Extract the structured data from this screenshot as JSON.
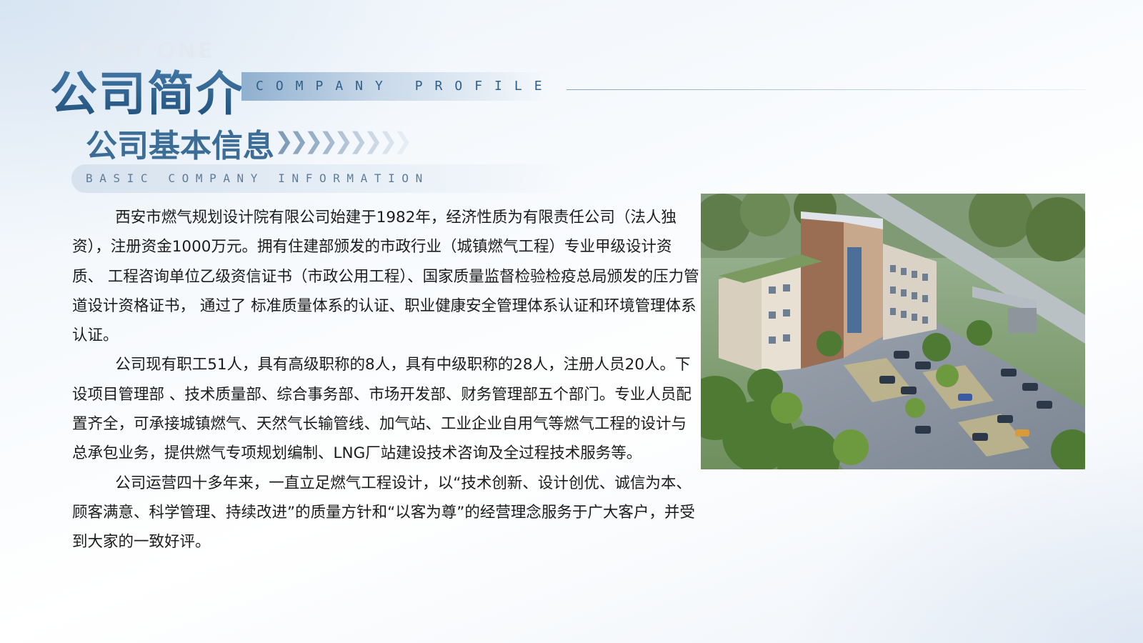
{
  "header": {
    "part_label": "PART ONE",
    "title": "公司简介",
    "subtitle_en": "COMPANY PROFILE"
  },
  "section": {
    "title": "公司基本信息",
    "subtitle_en": "BASIC COMPANY INFORMATION",
    "chevron_glyph": "❯",
    "chevron_count": 9
  },
  "body": {
    "paragraphs": [
      "西安市燃气规划设计院有限公司始建于1982年，经济性质为有限责任公司（法人独资），注册资金1000万元。拥有住建部颁发的市政行业（城镇燃气工程）专业甲级设计资质、 工程咨询单位乙级资信证书（市政公用工程）、国家质量监督检验检疫总局颁发的压力管道设计资格证书， 通过了 标准质量体系的认证、职业健康安全管理体系认证和环境管理体系认证。",
      "公司现有职工51人，具有高级职称的8人，具有中级职称的28人，注册人员20人。下设项目管理部 、技术质量部、综合事务部、市场开发部、财务管理部五个部门。专业人员配置齐全，可承接城镇燃气、天然气长输管线、加气站、工业企业自用气等燃气工程的设计与总承包业务，提供燃气专项规划编制、LNG厂站建设技术咨询及全过程技术服务等。",
      "公司运营四十多年来，一直立足燃气工程设计，以“技术创新、设计创优、诚信为本、顾客满意、科学管理、持续改进”的质量方针和“以客为尊”的经营理念服务于广大客户，并受到大家的一致好评。"
    ]
  },
  "image": {
    "subject": "building-aerial-rendering"
  },
  "colors": {
    "title": "#2a5b86",
    "accent": "#3c6d97",
    "band": "#8fb0cf",
    "chevron": "#7f9db9",
    "text": "#1c1c1c"
  }
}
